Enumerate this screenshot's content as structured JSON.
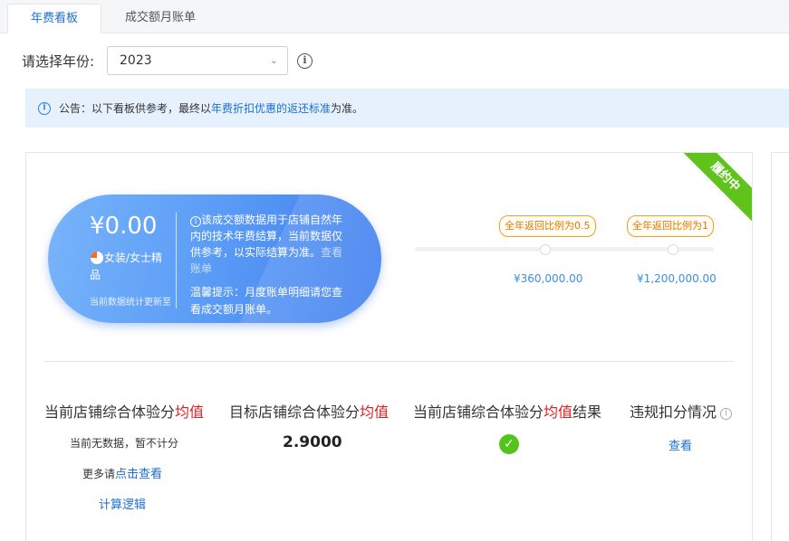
{
  "tabs": [
    {
      "label": "年费看板",
      "active": true
    },
    {
      "label": "成交额月账单",
      "active": false
    }
  ],
  "year_filter": {
    "label": "请选择年份:",
    "value": "2023",
    "info_icon": "info-circle-icon"
  },
  "notice": {
    "prefix": "公告：以下看板供参考，最终以",
    "link": "年费折扣优惠的返还标准",
    "suffix": "为准。"
  },
  "status_ribbon": "履约中",
  "summary": {
    "amount": "¥0.00",
    "category": "女装/女士精品",
    "stat_note": "当前数据统计更新至",
    "desc_main": "该成交额数据用于店铺自然年内的技术年费结算，当前数据仅供参考，以实际结算为准。",
    "desc_link": "查看账单",
    "tip": "温馨提示：月度账单明细请您查看成交额月账单。"
  },
  "milestones": [
    {
      "tag": "全年返回比例为0.5",
      "value": "¥360,000.00"
    },
    {
      "tag": "全年返回比例为1",
      "value": "¥1,200,000.00"
    }
  ],
  "metrics": {
    "current_avg": {
      "title_prefix": "当前店铺综合体验分",
      "title_highlight": "均值",
      "line1": "当前无数据，暂不计分",
      "line2_prefix": "更多请",
      "line2_link": "点击查看",
      "calc_link": "计算逻辑"
    },
    "target_avg": {
      "title_prefix": "目标店铺综合体验分",
      "title_highlight": "均值",
      "value": "2.9000"
    },
    "result": {
      "title_prefix": "当前店铺综合体验分",
      "title_highlight": "均值",
      "title_suffix": "结果",
      "status_icon": "check-circle-icon"
    },
    "violation": {
      "title": "违规扣分情况",
      "link": "查看"
    }
  },
  "colors": {
    "accent": "#1a6fd6",
    "highlight_red": "#e02020",
    "ribbon_green": "#5fc31c",
    "milestone_orange": "#e07a00"
  }
}
